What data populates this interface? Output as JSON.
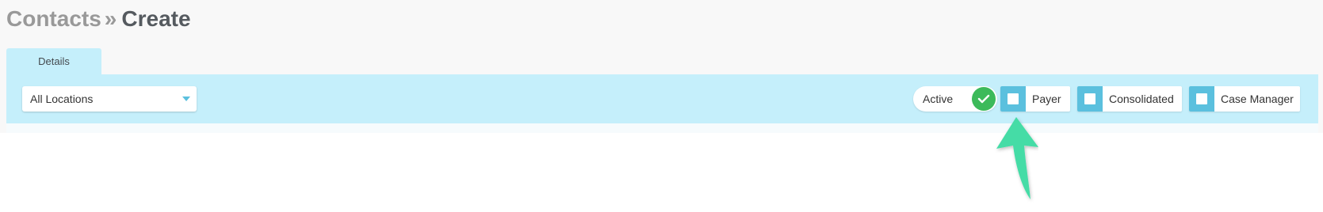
{
  "header": {
    "breadcrumb_parent": "Contacts",
    "breadcrumb_separator": "»",
    "breadcrumb_current": "Create"
  },
  "tabs": [
    {
      "label": "Details"
    }
  ],
  "toolbar": {
    "location_select": {
      "value": "All Locations"
    },
    "active_toggle": {
      "label": "Active",
      "on": true
    },
    "checkboxes": [
      {
        "label": "Payer",
        "checked": false
      },
      {
        "label": "Consolidated",
        "checked": false
      },
      {
        "label": "Case Manager",
        "checked": false
      }
    ]
  },
  "colors": {
    "accent": "#5bc0de",
    "panel": "#c5effb",
    "toggle_on": "#3cba5a",
    "annotation_arrow": "#45dca6"
  },
  "icons": {
    "toggle": "check-icon",
    "select": "caret-down-icon",
    "annotation": "arrow-up-icon"
  }
}
